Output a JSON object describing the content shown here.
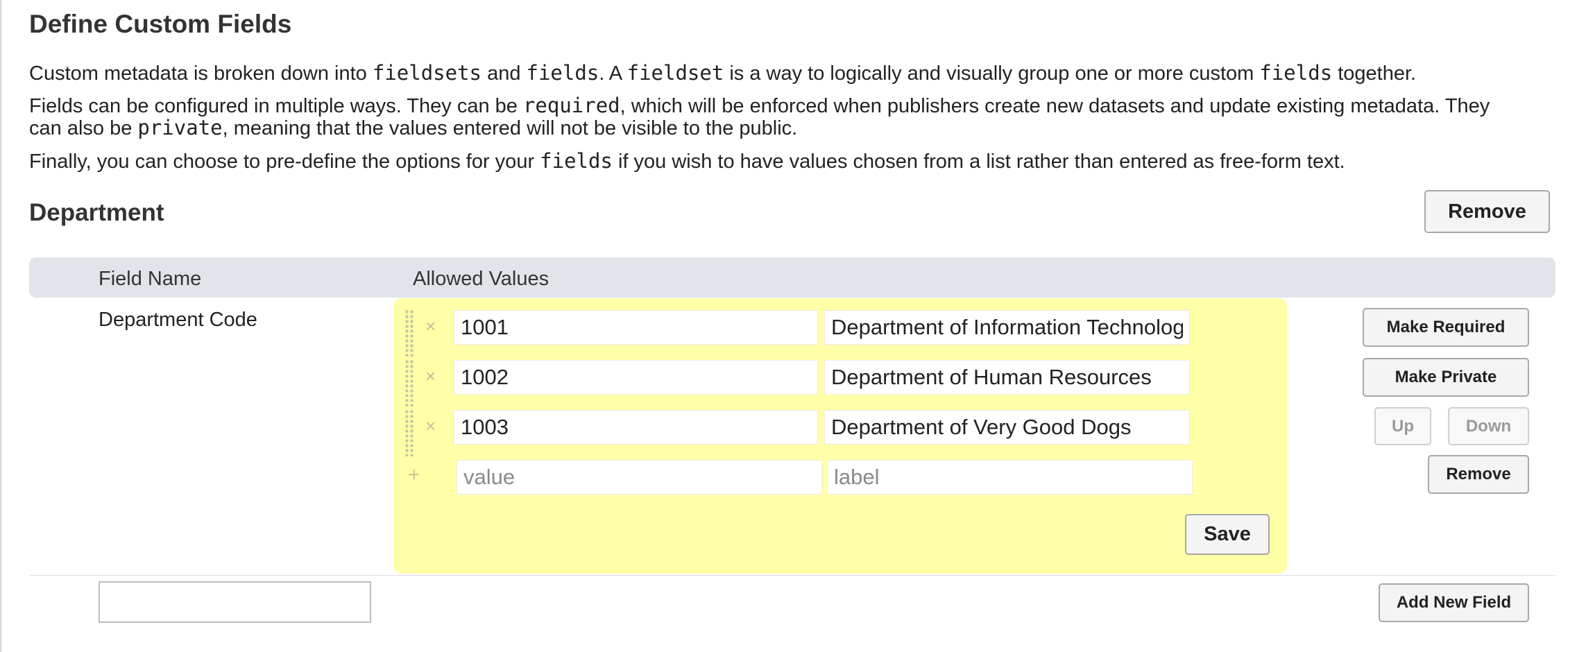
{
  "page": {
    "title": "Define Custom Fields",
    "intro": {
      "p1": [
        "Custom metadata is broken down into ",
        "fieldsets",
        " and ",
        "fields",
        ". A ",
        "fieldset",
        " is a way to logically and visually group one or more custom ",
        "fields",
        " together."
      ],
      "p2_line1": [
        "Fields can be configured in multiple ways. They can be ",
        "required",
        ", which will be enforced when publishers create new datasets and update existing metadata. They"
      ],
      "p2_line2": [
        "can also be ",
        "private",
        ", meaning that the values entered will not be visible to the public."
      ],
      "p3": [
        "Finally, you can choose to pre-define the options for your ",
        "fields",
        " if you wish to have values chosen from a list rather than entered as free-form text."
      ]
    }
  },
  "fieldset": {
    "title": "Department",
    "remove_label": "Remove",
    "columns": {
      "field_name": "Field Name",
      "allowed_values": "Allowed Values"
    },
    "field": {
      "name": "Department Code",
      "options": [
        {
          "value": "1001",
          "label": "Department of Information Technology"
        },
        {
          "value": "1002",
          "label": "Department of Human Resources"
        },
        {
          "value": "1003",
          "label": "Department of Very Good Dogs"
        }
      ],
      "new_option": {
        "value_placeholder": "value",
        "label_placeholder": "label"
      },
      "save_label": "Save",
      "actions": {
        "make_required": "Make Required",
        "make_private": "Make Private",
        "up": "Up",
        "down": "Down",
        "remove": "Remove"
      }
    },
    "add_field": {
      "input_value": "",
      "button_label": "Add New Field"
    }
  },
  "icons": {
    "drag": "drag-handle-icon",
    "delete": "close-icon",
    "add": "plus-icon"
  },
  "colors": {
    "allowed_values_bg": "#ffffa8",
    "table_header_bg": "#e1e4e8"
  }
}
